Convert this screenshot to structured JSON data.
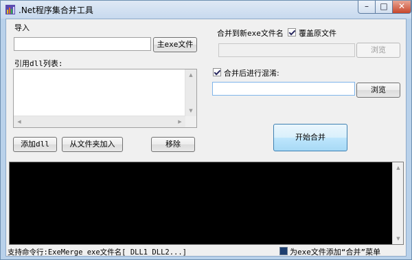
{
  "window": {
    "title": ".Net程序集合并工具",
    "icon": "app-icon",
    "controls": {
      "minimize": "–",
      "maximize": "□",
      "close": "✕"
    }
  },
  "import_section": {
    "label": "导入",
    "main_exe_value": "",
    "main_exe_button": "主exe文件",
    "dll_list_label": "引用dll列表:",
    "dll_items": [],
    "add_dll_button": "添加dll",
    "add_folder_button": "从文件夹加入",
    "remove_button": "移除"
  },
  "output_section": {
    "new_exe_label": "合并到新exe文件名",
    "overwrite_label": "覆盖原文件",
    "overwrite_checked": true,
    "new_exe_value": "",
    "browse1": "浏览",
    "obfuscate_label": "合并后进行混淆:",
    "obfuscate_checked": true,
    "obfuscate_value": "",
    "browse2": "浏览",
    "start_button": "开始合并"
  },
  "status": {
    "cmd_hint": "支持命令行:ExeMerge exe文件名[ DLL1 DLL2...]",
    "context_menu_label": "为exe文件添加“合并”菜单",
    "context_menu_checked": true
  },
  "colors": {
    "frame": "#b9d1ea",
    "client": "#f0f0f0",
    "console": "#000000"
  }
}
